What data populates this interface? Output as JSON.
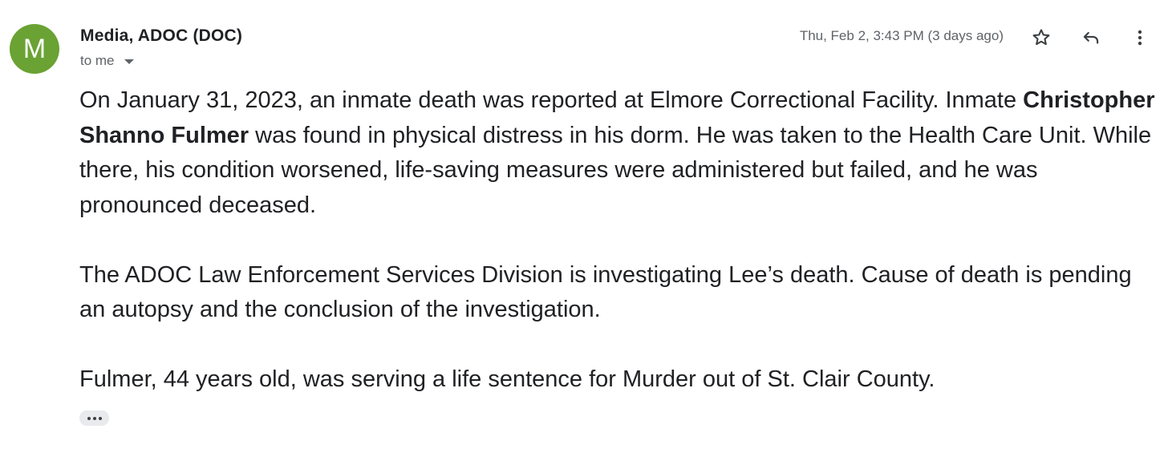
{
  "colors": {
    "avatar_bg": "#6aa233",
    "text": "#202124",
    "secondary_text": "#5f6368"
  },
  "email": {
    "avatar_letter": "M",
    "sender": "Media, ADOC (DOC)",
    "recipient_label": "to me",
    "timestamp": "Thu, Feb 2, 3:43 PM (3 days ago)",
    "actions": {
      "star_icon": "star-outline-icon",
      "reply_icon": "reply-icon",
      "more_icon": "more-vert-icon"
    },
    "body": {
      "p1_part1": "On January 31, 2023, an inmate death was reported at Elmore Correctional Facility. Inmate ",
      "p1_bold": "Christopher Shanno Fulmer",
      "p1_part2": " was found in physical distress in his dorm. He was taken to the Health Care Unit. While there, his condition worsened, life-saving measures were administered but failed, and he was pronounced deceased.",
      "p2": "The ADOC Law Enforcement Services Division is investigating Lee’s death. Cause of death is pending an autopsy and the conclusion of the investigation.",
      "p3": "Fulmer, 44 years old, was serving a life sentence for Murder out of St. Clair County."
    },
    "trimmed_content_icon": "ellipsis-icon"
  }
}
